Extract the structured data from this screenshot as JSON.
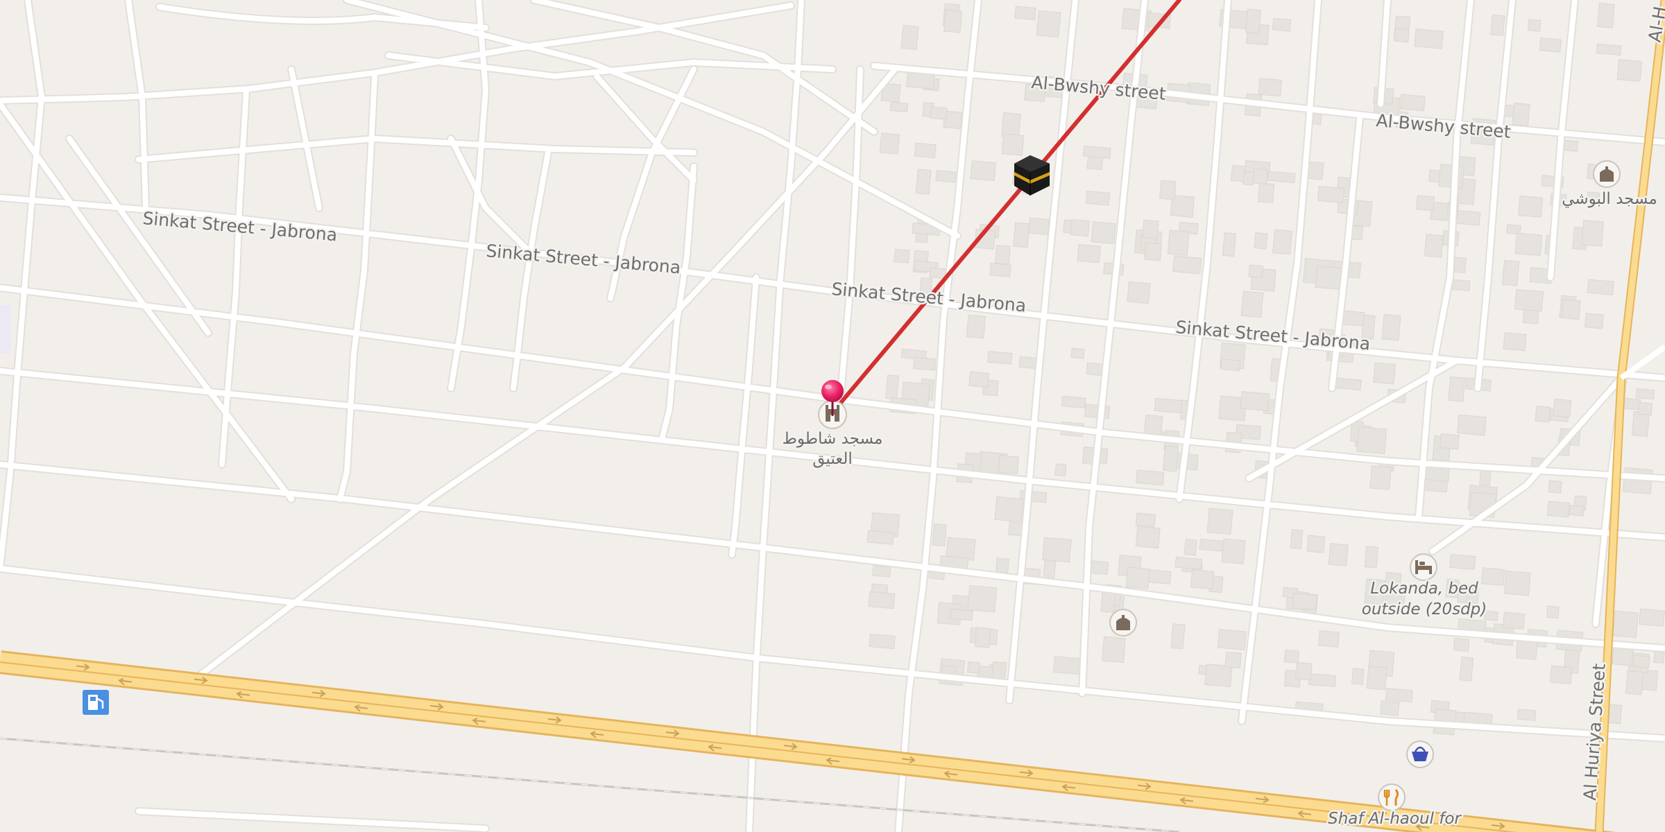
{
  "map": {
    "streets": [
      {
        "id": "sinkat-1",
        "name": "Sinkat Street - Jabrona"
      },
      {
        "id": "sinkat-2",
        "name": "Sinkat Street - Jabrona"
      },
      {
        "id": "sinkat-3",
        "name": "Sinkat Street - Jabrona"
      },
      {
        "id": "sinkat-4",
        "name": "Sinkat Street - Jabrona"
      },
      {
        "id": "bwshy-1",
        "name": "Al-Bwshy street"
      },
      {
        "id": "bwshy-2",
        "name": "Al-Bwshy street"
      },
      {
        "id": "huriya",
        "name": "Al Huriya Street"
      },
      {
        "id": "edge-top",
        "name": "Al-H"
      }
    ],
    "pois": {
      "mosque_selected": {
        "line1": "مسجد شاطوط",
        "line2": "العتيق",
        "icon": "mosque-icon"
      },
      "mosque_east": {
        "name": "مسجد البوشي",
        "icon": "mosque-icon"
      },
      "mosque_south": {
        "icon": "mosque-icon"
      },
      "lokanda": {
        "line1": "Lokanda, bed",
        "line2": "outside (20sdp)",
        "icon": "bed-icon"
      },
      "shop": {
        "icon": "shopping-basket-icon"
      },
      "restaurant": {
        "name": "Shaf Al-haoul for",
        "icon": "fork-knife-icon"
      },
      "fuel": {
        "icon": "fuel-station-icon"
      }
    },
    "qibla": {
      "marker_icon": "kaaba-icon",
      "pin_icon": "location-pin-icon",
      "line_color": "#d32f2f"
    },
    "colors": {
      "background": "#f2efeb",
      "road": "#ffffff",
      "highway": "#fbdb8f",
      "highway_border": "#e6b45c",
      "building": "#e6e2dd",
      "pin": "#e91e63"
    }
  }
}
